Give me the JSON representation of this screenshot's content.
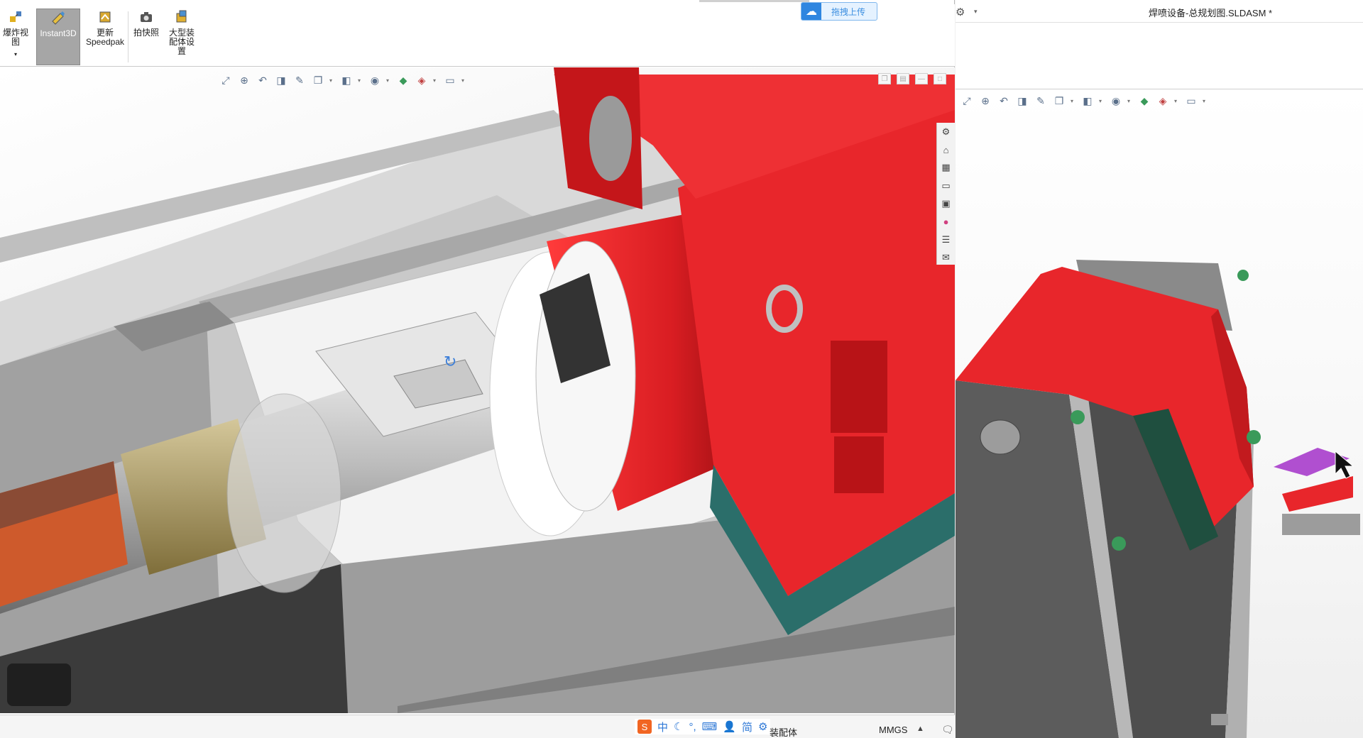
{
  "left_window": {
    "ribbon": {
      "explode_view": "爆炸视图",
      "instant3d": "Instant3D",
      "update_speedpak_line1": "更新",
      "update_speedpak_line2": "Speedpak",
      "snapshot": "拍快照",
      "large_assembly_line1": "大型装",
      "large_assembly_line2": "配体设",
      "large_assembly_line3": "置"
    },
    "upload_button": "拖拽上传",
    "view_toolbar_icons": [
      "zoom-to-fit-icon",
      "zoom-area-icon",
      "previous-view-icon",
      "section-view-icon",
      "dynamic-annotation-icon",
      "view-orientation-icon",
      "display-style-icon",
      "hide-show-items-icon",
      "edit-appearance-icon",
      "apply-scene-icon",
      "view-settings-icon"
    ],
    "task_pane_icons": [
      "solidworks-resources-icon",
      "home-icon",
      "design-library-icon",
      "file-explorer-icon",
      "view-palette-icon",
      "appearances-icon",
      "custom-properties-icon",
      "forum-icon"
    ],
    "statusbar": {
      "ime_items": [
        "中",
        "简"
      ],
      "document_type": "装配体",
      "units": "MMGS",
      "units_caret": "▲"
    }
  },
  "right_window": {
    "title": "焊喷设备-总规划图.SLDASM *",
    "options_icon": "gear-icon",
    "view_toolbar_icons": [
      "zoom-to-fit-icon",
      "zoom-area-icon",
      "previous-view-icon",
      "section-view-icon",
      "dynamic-annotation-icon",
      "view-orientation-icon",
      "display-style-icon",
      "hide-show-items-icon",
      "edit-appearance-icon",
      "apply-scene-icon",
      "view-settings-icon"
    ]
  },
  "colors": {
    "part_red": "#e8262b",
    "frame_gray": "#6b6b6b",
    "plate_white": "#f2f2f2",
    "accent_green": "#3a9a5a",
    "purple_part": "#b04fd0",
    "upload_blue": "#2f86e0"
  }
}
